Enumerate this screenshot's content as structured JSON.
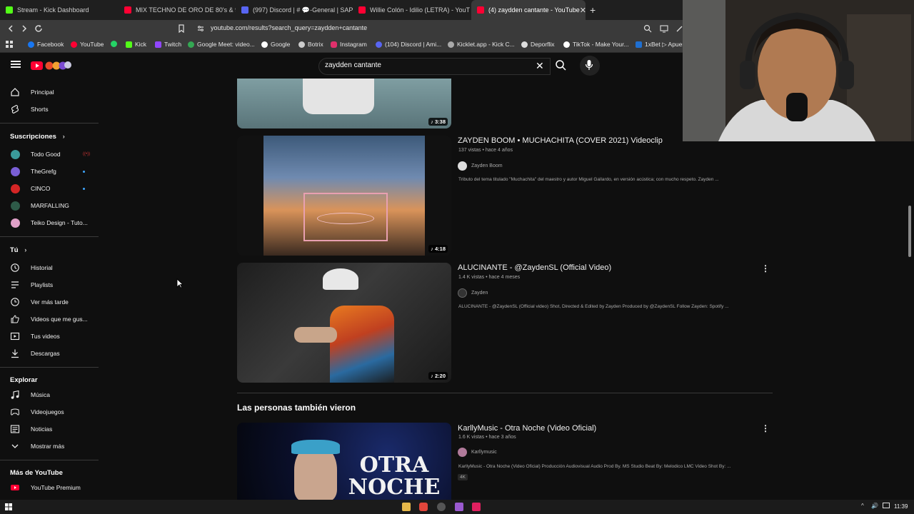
{
  "browser": {
    "tabs": [
      {
        "label": "Stream - Kick Dashboard",
        "color": "#53fc18"
      },
      {
        "label": "MIX TECHNO DE ORO DE 80's & 90's",
        "color": "#ff0033"
      },
      {
        "label": "(997) Discord | # 💬-General | SAPOLI",
        "color": "#5865f2"
      },
      {
        "label": "Willie Colón - Idilio (LETRA) - YouTub",
        "color": "#ff0033"
      },
      {
        "label": "(4) zaydden cantante - YouTube",
        "color": "#ff0033"
      }
    ],
    "close_glyph": "✕",
    "new_tab_glyph": "+",
    "url": "youtube.com/results?search_query=zaydden+cantante",
    "bookmarks": [
      {
        "label": "Facebook",
        "color": "#1877f2"
      },
      {
        "label": "YouTube",
        "color": "#ff0033"
      },
      {
        "label": "",
        "color": "#25d366"
      },
      {
        "label": "Kick",
        "color": "#53fc18"
      },
      {
        "label": "Twitch",
        "color": "#9146ff"
      },
      {
        "label": "Google Meet: video...",
        "color": "#34a853"
      },
      {
        "label": "Google",
        "color": "#ffffff"
      },
      {
        "label": "Botrix",
        "color": "#cccccc"
      },
      {
        "label": "Instagram",
        "color": "#e1306c"
      },
      {
        "label": "(104) Discord | Ami...",
        "color": "#5865f2"
      },
      {
        "label": "Kicklet.app - Kick C...",
        "color": "#aaaaaa"
      },
      {
        "label": "Deporflix",
        "color": "#dddddd"
      },
      {
        "label": "TikTok - Make Your...",
        "color": "#ffffff"
      },
      {
        "label": "1xBet ▷ Apues",
        "color": "#1f6fd1"
      }
    ]
  },
  "youtube": {
    "search_query": "zaydden cantante",
    "sidebar": {
      "main": [
        {
          "label": "Principal",
          "icon": "home-icon"
        },
        {
          "label": "Shorts",
          "icon": "shorts-icon"
        }
      ],
      "subscriptions_heading": "Suscripciones",
      "subscriptions": [
        {
          "label": "Todo Good",
          "color": "#3a9a9a",
          "status": "live"
        },
        {
          "label": "TheGrefg",
          "color": "#7a5fd6",
          "status": "new"
        },
        {
          "label": "CINCO",
          "color": "#d42525",
          "status": "new"
        },
        {
          "label": "MARFALLING",
          "color": "#2e5a48",
          "status": ""
        },
        {
          "label": "Teiko Design - Tuto...",
          "color": "#e0a0c8",
          "status": ""
        }
      ],
      "live_glyph": "((•))",
      "you_heading": "Tú",
      "you": [
        {
          "label": "Historial",
          "icon": "history-icon"
        },
        {
          "label": "Playlists",
          "icon": "playlists-icon"
        },
        {
          "label": "Ver más tarde",
          "icon": "watch-later-icon"
        },
        {
          "label": "Videos que me gus...",
          "icon": "like-icon"
        },
        {
          "label": "Tus videos",
          "icon": "your-videos-icon"
        },
        {
          "label": "Descargas",
          "icon": "download-icon"
        }
      ],
      "explore_heading": "Explorar",
      "explore": [
        {
          "label": "Música",
          "icon": "music-icon"
        },
        {
          "label": "Videojuegos",
          "icon": "gaming-icon"
        },
        {
          "label": "Noticias",
          "icon": "news-icon"
        },
        {
          "label": "Mostrar más",
          "icon": "chevron-down-icon"
        }
      ],
      "more_heading": "Más de YouTube",
      "more": [
        {
          "label": "YouTube Premium",
          "icon": "youtube-premium-icon"
        }
      ]
    },
    "results": [
      {
        "title": "",
        "duration": "3:38",
        "colors": [
          "#6f8d92",
          "#4a6166"
        ]
      },
      {
        "title": "ZAYDEN BOOM • MUCHACHITA (COVER 2021) Videoclip",
        "meta": "137 vistas • hace 4 años",
        "channel": "Zayden Boom",
        "desc": "Tributo del tema titulado \"Muchachita\" del maestro y autor Miguel Gallardo, en versión acústica; con mucho respeto. Zayden ...",
        "duration": "4:18",
        "colors": [
          "#4a6680",
          "#c27a4a"
        ]
      },
      {
        "title": "ALUCINANTE - @ZaydenSL (Official Video)",
        "meta": "1.4 K vistas • hace 4 meses",
        "channel": "Zayden",
        "desc": "ALUCINANTE - @ZaydenSL (Official video) Shot, Directed & Edited by Zayden Produced by @ZaydenSL Follow Zayden: Spotify ...",
        "duration": "2:20",
        "colors": [
          "#2a2a2a",
          "#c45a20"
        ]
      }
    ],
    "shelf_title": "Las personas también vieron",
    "shelf": [
      {
        "title": "KarllyMusic - Otra Noche (Video Oficial)",
        "meta": "1.6 K vistas • hace 3 años",
        "channel": "Karllymusic",
        "desc": "KarllyMusic - Otra Noche (Video Oficial) Producción Audiovisual Audio Prod By. MS Studio Beat By: Melodico LMC Video Shot By: ...",
        "badge": "4K",
        "thumb_text": "OTRA\nNOCHE"
      }
    ]
  },
  "taskbar": {
    "clock": "11:39"
  }
}
